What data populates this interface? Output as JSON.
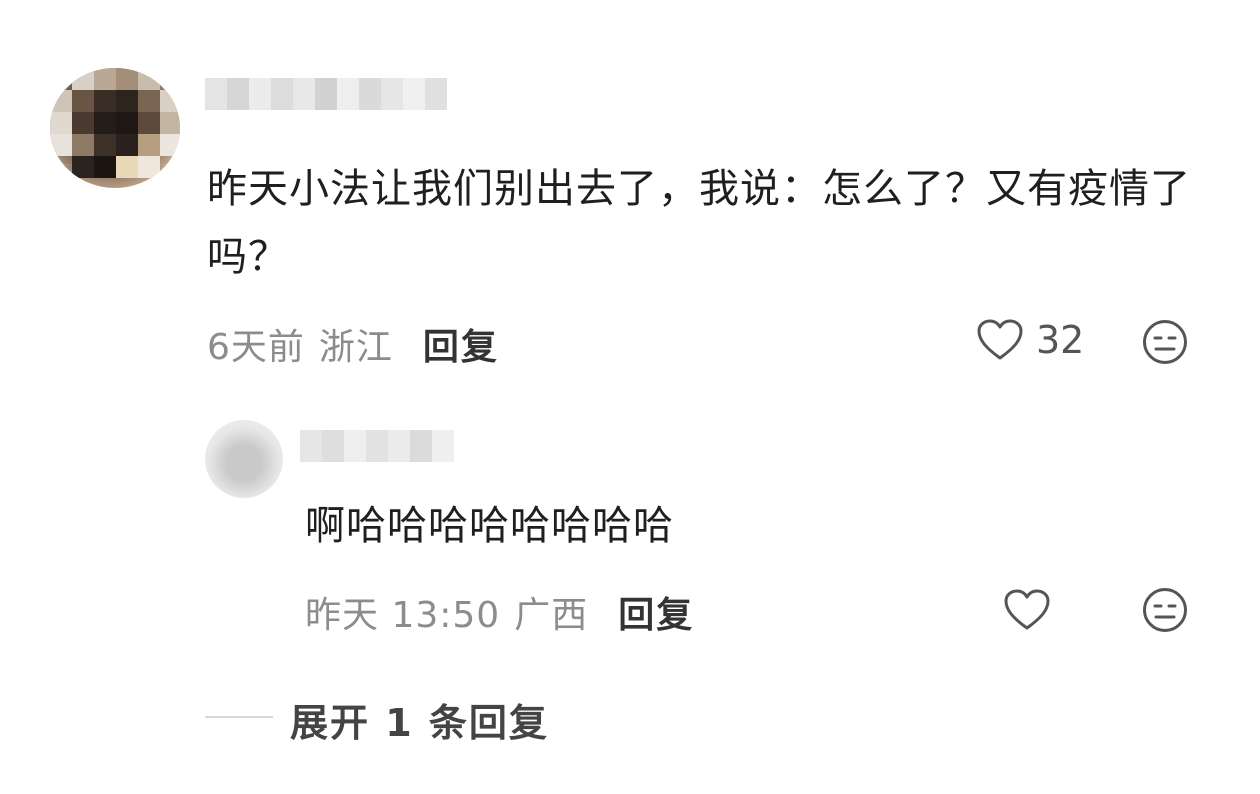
{
  "comment": {
    "text": "昨天小法让我们别出去了，我说：怎么了？又有疫情了吗？",
    "time": "6天前",
    "location": "浙江",
    "reply_label": "回复",
    "like_count": "32"
  },
  "reply": {
    "text": "啊哈哈哈哈哈哈哈哈",
    "time": "昨天 13:50",
    "location": "广西",
    "reply_label": "回复"
  },
  "expand": {
    "label": "展开 1 条回复"
  },
  "icons": {
    "like": "heart-outline-icon",
    "dislike": "neutral-face-icon"
  },
  "colors": {
    "text": "#1f1f1f",
    "meta": "#8c8c8c",
    "icon": "#555555"
  }
}
